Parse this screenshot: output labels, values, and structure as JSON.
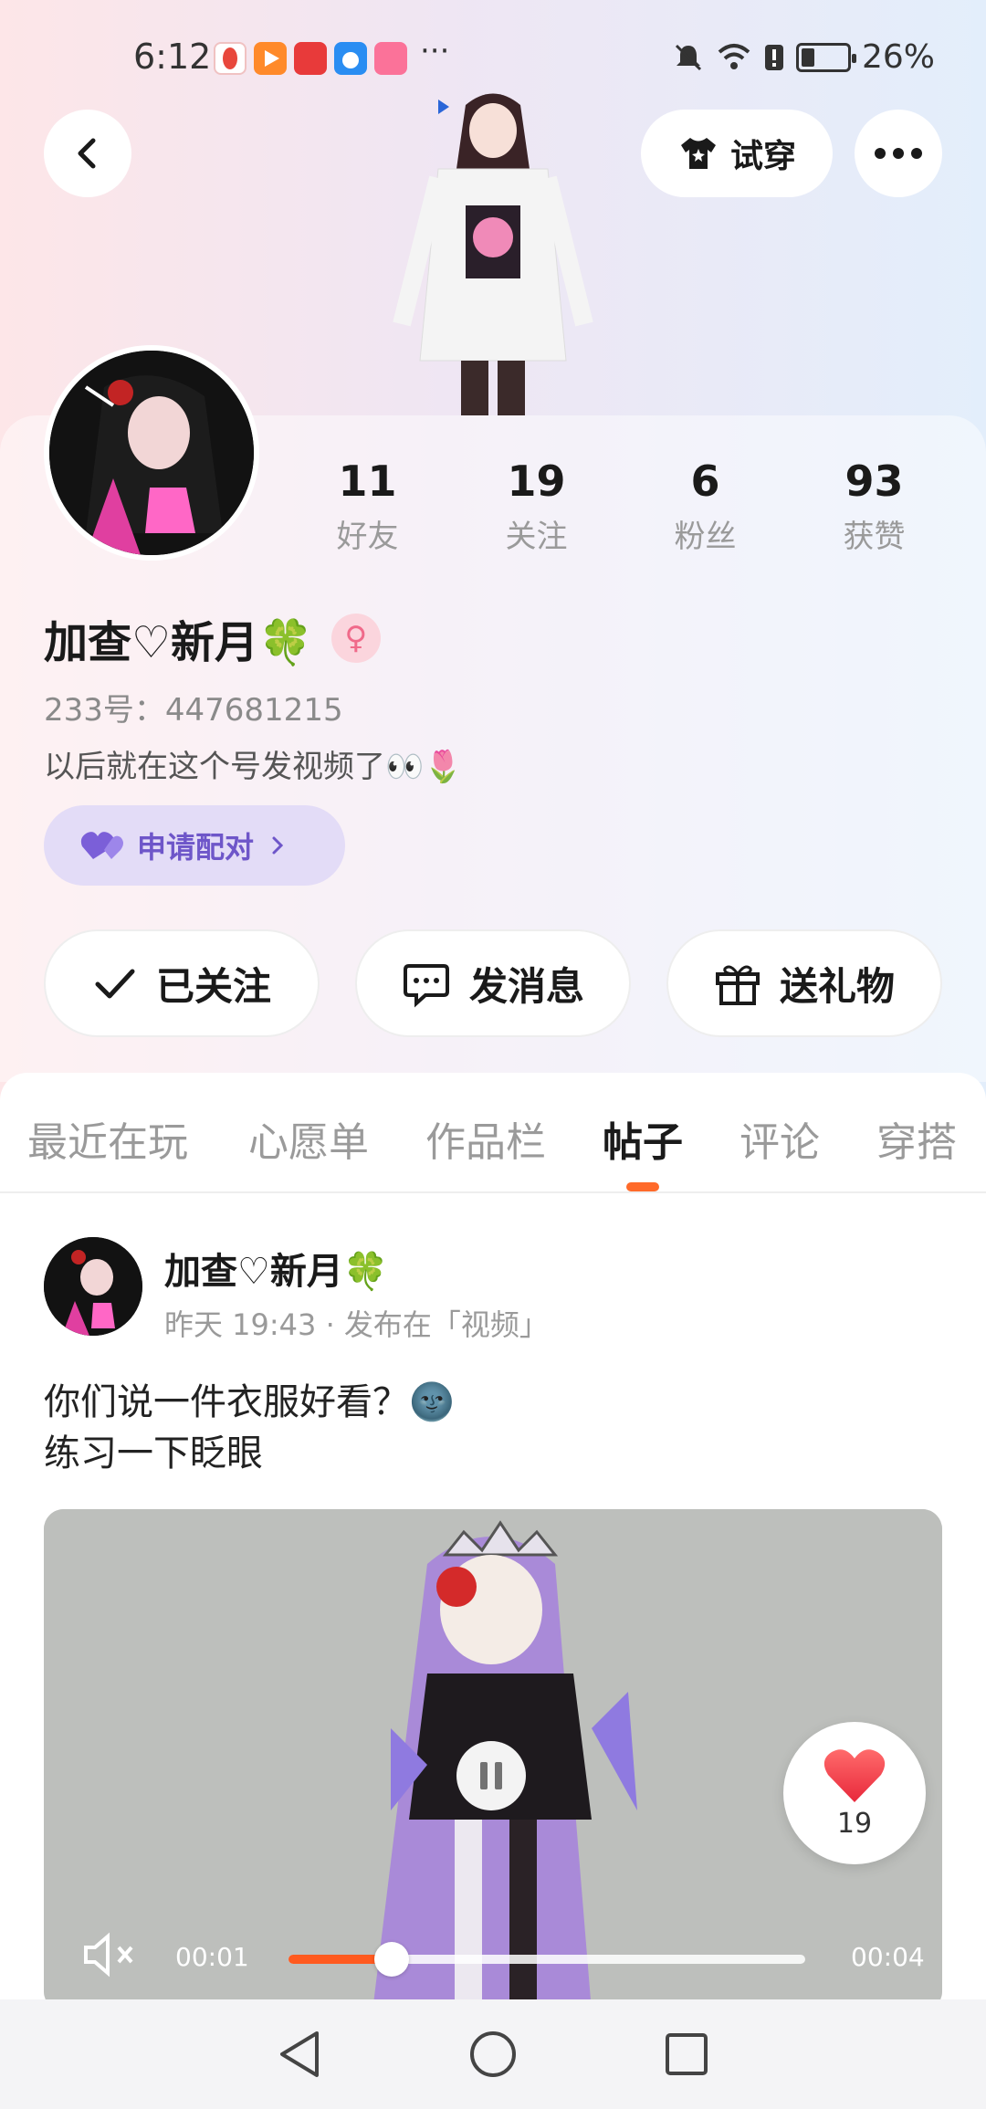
{
  "status_bar": {
    "time": "6:12",
    "more_indicator": "···",
    "battery_percent": "26%",
    "battery_level": 0.26,
    "app_icons": [
      "xiaohongshu-app-icon",
      "video-app-icon",
      "huawei-app-icon",
      "weather-app-icon",
      "bilibili-app-icon"
    ],
    "status_icons": [
      "bell-muted-icon",
      "wifi-icon",
      "alert-icon",
      "battery-icon"
    ]
  },
  "header": {
    "try_on_label": "试穿"
  },
  "profile": {
    "stats": [
      {
        "value": "11",
        "label": "好友"
      },
      {
        "value": "19",
        "label": "关注"
      },
      {
        "value": "6",
        "label": "粉丝"
      },
      {
        "value": "93",
        "label": "获赞"
      }
    ],
    "name": "加查♡新月🍀",
    "gender_symbol": "♀",
    "uid": "233号：447681215",
    "bio": "以后就在这个号发视频了👀🌷",
    "pair_label": "申请配对"
  },
  "actions": {
    "followed": "已关注",
    "message": "发消息",
    "gift": "送礼物"
  },
  "tabs": [
    {
      "label": "最近在玩"
    },
    {
      "label": "心愿单"
    },
    {
      "label": "作品栏"
    },
    {
      "label": "帖子"
    },
    {
      "label": "评论"
    },
    {
      "label": "穿搭"
    }
  ],
  "active_tab": "帖子",
  "post": {
    "author": "加查♡新月🍀",
    "meta": "昨天 19:43 · 发布在「视频」",
    "text_line1": "你们说一件衣服好看？🌚",
    "text_line2": "练习一下眨眼",
    "like_count": "19",
    "video": {
      "current_time": "00:01",
      "total_time": "00:04",
      "progress": 0.2
    }
  },
  "colors": {
    "accent": "#ff5a1f",
    "pair_purple": "#6e56c9",
    "like_red": "#f2404a"
  }
}
